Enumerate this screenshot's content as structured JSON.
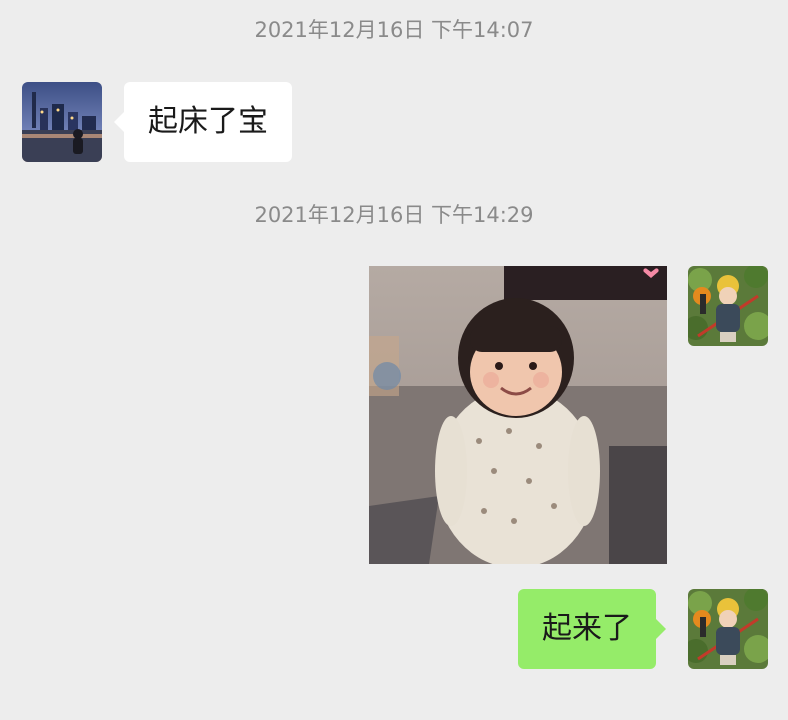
{
  "chat": {
    "timestamps": [
      "2021年12月16日 下午14:07",
      "2021年12月16日 下午14:29"
    ],
    "messages": [
      {
        "side": "left",
        "type": "text",
        "text": "起床了宝",
        "avatar": "contact-avatar-city-night"
      },
      {
        "side": "right",
        "type": "image",
        "image": "toddler-smiling-photo",
        "avatar": "self-avatar-child-plants"
      },
      {
        "side": "right",
        "type": "text",
        "text": "起来了",
        "avatar": "self-avatar-child-plants"
      }
    ]
  },
  "colors": {
    "background": "#ededed",
    "incoming_bubble": "#ffffff",
    "outgoing_bubble": "#95ec69",
    "timestamp_text": "#8a8a8a"
  }
}
